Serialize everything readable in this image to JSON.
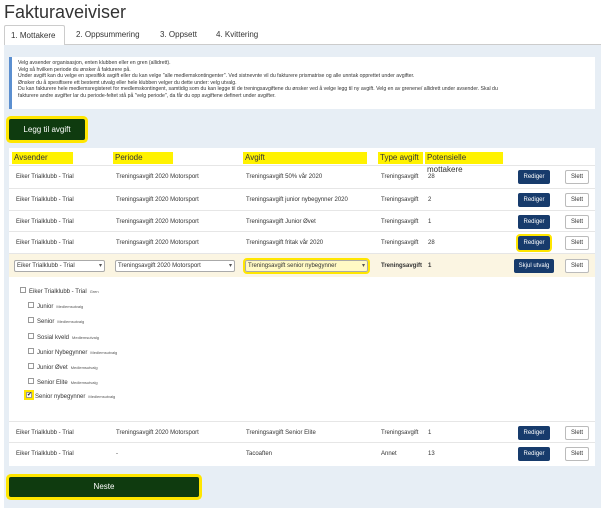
{
  "title": "Fakturaveiviser",
  "tabs": [
    {
      "label": "1. Mottakere"
    },
    {
      "label": "2. Oppsummering"
    },
    {
      "label": "3. Oppsett"
    },
    {
      "label": "4. Kvittering"
    }
  ],
  "info_lines": [
    "Velg avsender organisasjon, enten klubben eller en gren (allidrett).",
    "Velg så hvilken periode du ønsker å fakturere på.",
    "Under avgift kan du velge en spesifikk avgift eller du kan velge \"alle medlemskontingenter\". Ved sistnevnte vil du fakturere prismatrise og alle unntak opprettet under avgifter.",
    "Ønsker du å spesifisere ett bestemt utvalg eller hele klubben velger du dette under: velg utvalg.",
    "Du kan fakturere hele medlemsregisteret for medlemskontingent, samtidig som du kan legge til de treningsavgiftene du ønsker ved å velge legg til ny avgift. Velg en av grenene/ allidrett under avsender. Skal du",
    "fakturere andre avgifter lar du periode-feltet stå på \"velg periode\", da får du opp avgiftene definert under avgifter."
  ],
  "add_button": "Legg til avgift",
  "headers": {
    "avsender": "Avsender",
    "periode": "Periode",
    "avgift": "Avgift",
    "type": "Type avgift",
    "mottakere": "Potensielle mottakere"
  },
  "rows_top": [
    {
      "avsender": "Eiker Trialklubb - Trial",
      "periode": "Treningsavgift 2020 Motorsport",
      "avgift": "Treningsavgift 50% vår 2020",
      "type": "Treningsavgift",
      "count": "28"
    },
    {
      "avsender": "Eiker Trialklubb - Trial",
      "periode": "Treningsavgift 2020 Motorsport",
      "avgift": "Treningsavgift junior nybegynner 2020",
      "type": "Treningsavgift",
      "count": "2"
    },
    {
      "avsender": "Eiker Trialklubb - Trial",
      "periode": "Treningsavgift 2020 Motorsport",
      "avgift": "Treningsavgift Junior Øvet",
      "type": "Treningsavgift",
      "count": "1"
    },
    {
      "avsender": "Eiker Trialklubb - Trial",
      "periode": "Treningsavgift 2020 Motorsport",
      "avgift": "Treningsavgift fritak vår 2020",
      "type": "Treningsavgift",
      "count": "28"
    }
  ],
  "edit_label": "Rediger",
  "delete_label": "Slett",
  "edit_row": {
    "avsender": "Eiker Trialklubb - Trial",
    "periode": "Treningsavgift 2020 Motorsport",
    "avgift": "Treningsavgift senior nybegynner",
    "type": "Treningsavgift",
    "count": "1",
    "hide_label": "Skjul utvalg"
  },
  "tree": {
    "root": {
      "label": "Eiker Trialklubb - Trial",
      "tag": "Gren"
    },
    "items": [
      {
        "label": "Junior",
        "tag": "Medlemsutvalg",
        "checked": false
      },
      {
        "label": "Senior",
        "tag": "Medlemsutvalg",
        "checked": false
      },
      {
        "label": "Sosial kveld",
        "tag": "Medlemsutvalg",
        "checked": false
      },
      {
        "label": "Junior Nybegynner",
        "tag": "Medlemsutvalg",
        "checked": false
      },
      {
        "label": "Junior Øvet",
        "tag": "Medlemsutvalg",
        "checked": false
      },
      {
        "label": "Senior Elite",
        "tag": "Medlemsutvalg",
        "checked": false
      },
      {
        "label": "Senior nybegynner",
        "tag": "Medlemsutvalg",
        "checked": true
      }
    ]
  },
  "rows_bottom": [
    {
      "avsender": "Eiker Trialklubb - Trial",
      "periode": "Treningsavgift 2020 Motorsport",
      "avgift": "Treningsavgift Senior Elite",
      "type": "Treningsavgift",
      "count": "1"
    },
    {
      "avsender": "Eiker Trialklubb - Trial",
      "periode": "-",
      "avgift": "Tacoaften",
      "type": "Annet",
      "count": "13"
    }
  ],
  "next_button": "Neste",
  "colors": {
    "highlight": "#ffe600",
    "primary": "#173b6c",
    "green": "#0f3b0f",
    "panel": "#e7eef5"
  }
}
